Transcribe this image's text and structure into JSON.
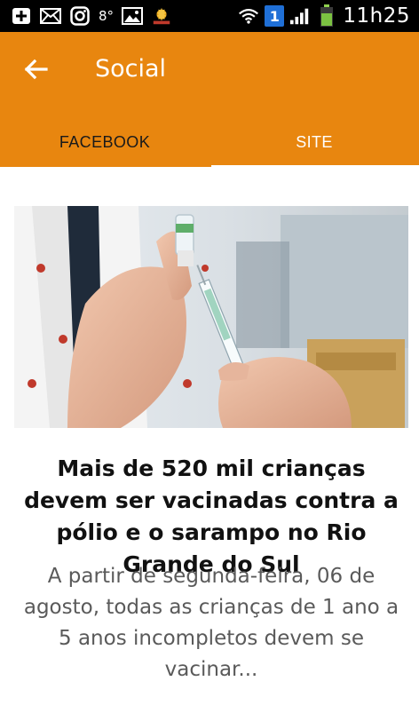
{
  "status_bar": {
    "temperature": "8°",
    "notification_count": "1",
    "time": "11h25"
  },
  "app_bar": {
    "title": "Social",
    "accent_color": "#e8860f"
  },
  "tabs": [
    {
      "label": "FACEBOOK",
      "selected": true
    },
    {
      "label": "SITE",
      "selected": false
    }
  ],
  "article": {
    "title": "Mais de 520 mil crianças devem ser vacinadas contra a pólio e o sarampo no Rio Grande do Sul",
    "excerpt": "A partir de segunda-feira, 06 de agosto, todas as crianças de 1 ano a 5 anos incompletos devem se vacinar..."
  }
}
